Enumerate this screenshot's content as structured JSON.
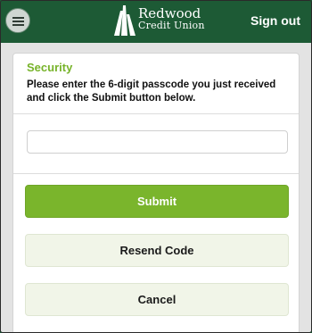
{
  "header": {
    "brand_line1": "Redwood",
    "brand_line2": "Credit Union",
    "signout_label": "Sign out",
    "menu_icon": "hamburger-menu-icon",
    "bg_color": "#1d5a35"
  },
  "form": {
    "title": "Security",
    "instructions": "Please enter the 6-digit passcode you just received and click the Submit button below.",
    "passcode_value": "",
    "passcode_placeholder": "",
    "submit_label": "Submit",
    "resend_label": "Resend Code",
    "cancel_label": "Cancel",
    "accent_color": "#77b32a"
  }
}
